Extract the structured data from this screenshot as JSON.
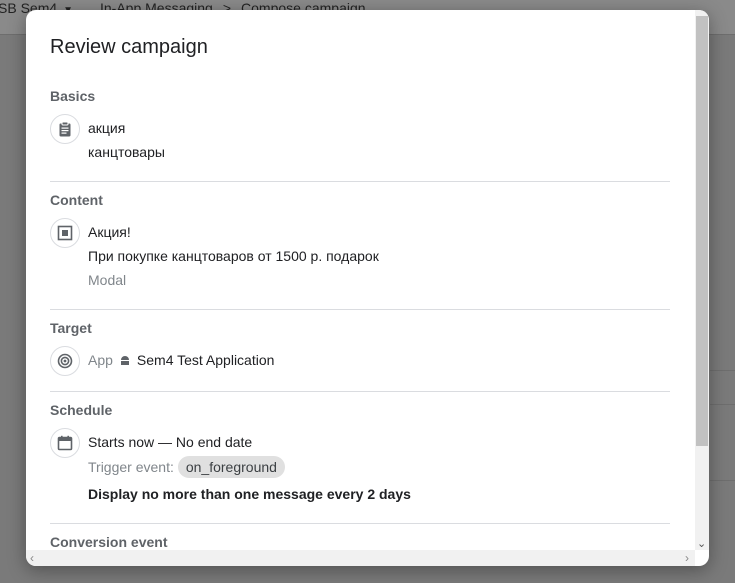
{
  "background": {
    "project": "SB Sem4",
    "breadcrumb": [
      "In-App Messaging",
      "Compose campaign"
    ],
    "breadcrumb_separator": ">"
  },
  "dialog": {
    "title": "Review campaign",
    "basics": {
      "label": "Basics",
      "icon": "clipboard-icon",
      "name": "акция",
      "description": "канцтовары"
    },
    "content": {
      "label": "Content",
      "icon": "message-box-icon",
      "title": "Акция!",
      "body": "При покупке канцтоваров от 1500 р. подарок",
      "layout": "Modal"
    },
    "target": {
      "label": "Target",
      "icon": "target-icon",
      "app_label": "App",
      "app_name": "Sem4 Test Application"
    },
    "schedule": {
      "label": "Schedule",
      "icon": "calendar-icon",
      "timing": "Starts now — No end date",
      "trigger_label": "Trigger event:",
      "trigger_event": "on_foreground",
      "frequency": "Display no more than one message every 2 days"
    },
    "conversion": {
      "label": "Conversion event"
    }
  }
}
